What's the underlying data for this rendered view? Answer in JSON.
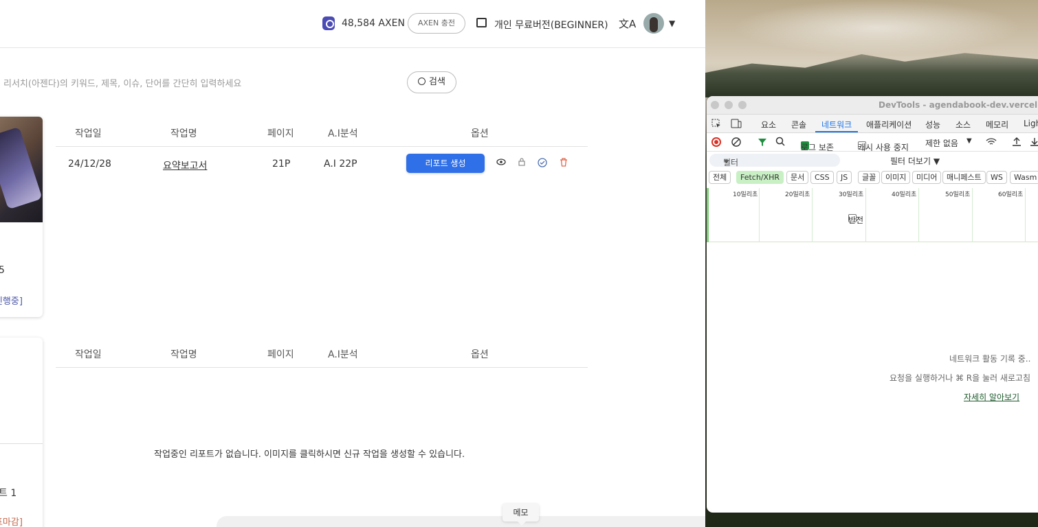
{
  "header": {
    "axen_balance": "48,584 AXEN",
    "charge_button": "AXEN 충전",
    "plan_label": "개인 무료버전(BEGINNER)",
    "translate_icon": "文A",
    "caret": "▼"
  },
  "search": {
    "placeholder": "리서치(아젠다)의 키워드, 제목, 이슈, 단어를 간단히 입력하세요",
    "button_label": "검색"
  },
  "cards": [
    {
      "number": "5",
      "status": "표진행중]"
    },
    {
      "number": "트 1",
      "status": "투표마감]"
    }
  ],
  "table1": {
    "headers": [
      "작업일",
      "작업명",
      "페이지",
      "A.I분석",
      "옵션"
    ],
    "rows": [
      {
        "date": "24/12/28",
        "name": "요약보고서",
        "pages": "21P",
        "ai": "A.I 22P",
        "action": "리포트 생성"
      }
    ]
  },
  "table2": {
    "headers": [
      "작업일",
      "작업명",
      "페이지",
      "A.I분석",
      "옵션"
    ],
    "empty_message": "작업중인 리포트가 없습니다. 이미지를 클릭하시면 신규 작업을 생성할 수 있습니다."
  },
  "memo_label": "메모",
  "devtools": {
    "title": "DevTools - agendabook-dev.vercel.a",
    "tabs": [
      "요소",
      "콘솔",
      "네트워크",
      "애플리케이션",
      "성능",
      "소스",
      "메모리",
      "Ligh"
    ],
    "active_tab": "네트워크",
    "preserve_log": "로그 보존",
    "disable_cache": "캐시 사용 중지",
    "throttle": "제한 없음",
    "filter_placeholder": "필터",
    "invert": "반전",
    "more_filters": "필터 더보기 ▼",
    "type_filters": [
      "전체",
      "Fetch/XHR",
      "문서",
      "CSS",
      "JS",
      "글꼴",
      "이미지",
      "미디어",
      "매니페스트",
      "WS",
      "Wasm"
    ],
    "active_type": "Fetch/XHR",
    "timeline_labels": [
      "10밀리초",
      "20밀리초",
      "30밀리초",
      "40밀리초",
      "50밀리초",
      "60밀리초"
    ],
    "recording_msg": "네트워크 활동 기록 중..",
    "hint_msg": "요청을 실행하거나 ⌘ R을 눌러 새로고침",
    "learn_more": "자세히 알아보기"
  },
  "colors": {
    "primary": "#2f6fe8",
    "status_ongoing": "#4b56a6",
    "status_closed": "#c4664a",
    "devtools_active": "#1a73e8",
    "devtools_filter_on": "#c8f0c4"
  }
}
